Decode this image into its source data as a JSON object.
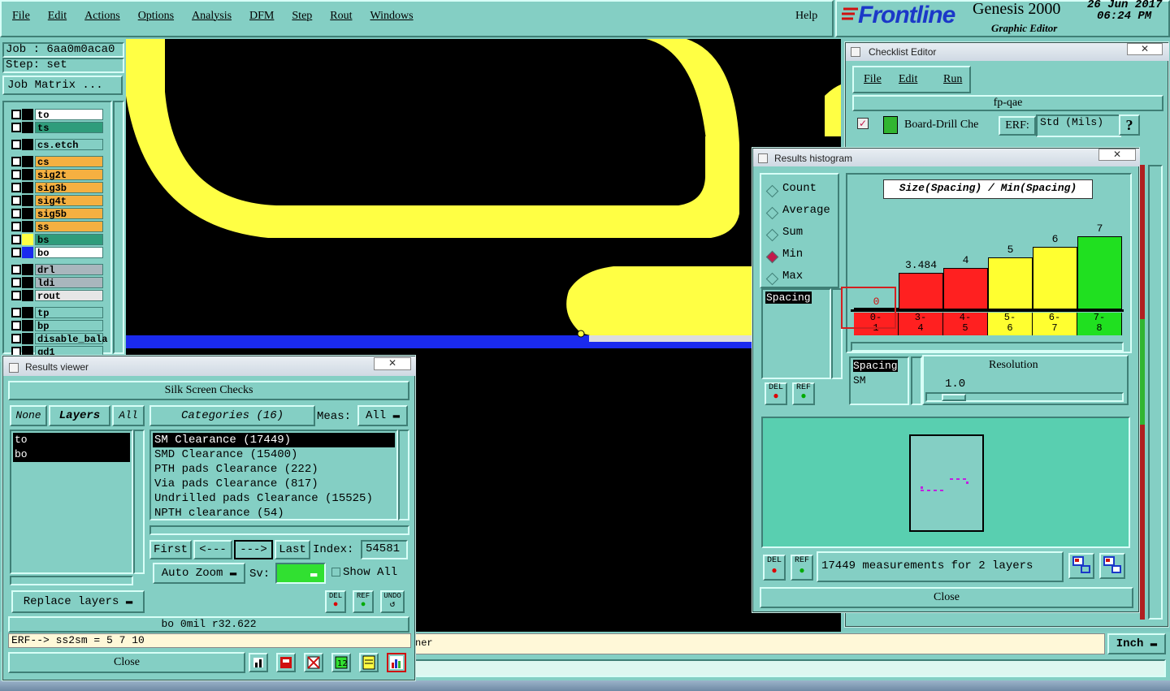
{
  "menu": [
    "File",
    "Edit",
    "Actions",
    "Options",
    "Analysis",
    "DFM",
    "Step",
    "Rout",
    "Windows"
  ],
  "help": "Help",
  "brand": {
    "logo": "Frontline",
    "product": "Genesis 2000",
    "subtitle": "Graphic Editor",
    "date": "26 Jun 2017",
    "time": "06:24 PM"
  },
  "job": {
    "job_label": "Job : 6aa0m0aca0",
    "step_label": "Step: set",
    "matrix_button": "Job Matrix ..."
  },
  "layers": [
    {
      "name": "to",
      "color": "#ffffff",
      "swatch": "#000000"
    },
    {
      "name": "ts",
      "color": "#2f9c7b",
      "swatch": "#000000"
    },
    {
      "name": "cs.etch",
      "color": "#84cfc4",
      "swatch": "#000000"
    },
    {
      "name": "cs",
      "color": "#f5b041",
      "swatch": "#000000"
    },
    {
      "name": "sig2t",
      "color": "#f5b041",
      "swatch": "#000000"
    },
    {
      "name": "sig3b",
      "color": "#f5b041",
      "swatch": "#000000"
    },
    {
      "name": "sig4t",
      "color": "#f5b041",
      "swatch": "#000000"
    },
    {
      "name": "sig5b",
      "color": "#f5b041",
      "swatch": "#000000"
    },
    {
      "name": "ss",
      "color": "#f5b041",
      "swatch": "#000000"
    },
    {
      "name": "bs",
      "color": "#2f9c7b",
      "swatch": "#ffff44"
    },
    {
      "name": "bo",
      "color": "#ffffff",
      "swatch": "#1a2aee"
    },
    {
      "name": "drl",
      "color": "#a9b6bd",
      "swatch": "#000000"
    },
    {
      "name": "ldi",
      "color": "#a9b6bd",
      "swatch": "#000000"
    },
    {
      "name": "rout",
      "color": "#e6e6e6",
      "swatch": "#000000"
    },
    {
      "name": "tp",
      "color": "#84cfc4",
      "swatch": "#000000"
    },
    {
      "name": "bp",
      "color": "#84cfc4",
      "swatch": "#000000"
    },
    {
      "name": "disable_bala",
      "color": "#84cfc4",
      "swatch": "#000000"
    },
    {
      "name": "gd1",
      "color": "#84cfc4",
      "swatch": "#000000"
    }
  ],
  "results_viewer": {
    "title": "Results viewer",
    "heading": "Silk Screen Checks",
    "none": "None",
    "layers": "Layers",
    "all": "All",
    "layer_items": [
      "to",
      "bo"
    ],
    "categories_btn": "Categories (16)",
    "meas_label": "Meas:",
    "meas_value": "All",
    "categories": [
      "SM Clearance (17449)",
      "SMD Clearance (15400)",
      "PTH pads Clearance (222)",
      "Via pads Clearance (817)",
      "Undrilled pads Clearance (15525)",
      "NPTH clearance (54)"
    ],
    "first": "First",
    "prev": "<---",
    "next": "--->",
    "last": "Last",
    "index_label": "Index:",
    "index_value": "54581",
    "auto_zoom": "Auto Zoom",
    "sv_label": "Sv:",
    "show_all": "Show All",
    "replace_layers": "Replace layers",
    "del": "DEL",
    "ref": "REF",
    "undo": "UNDO",
    "status": "bo 0mil   r32.622",
    "erf_line": "ERF--> ss2sm = 5 7 10",
    "close": "Close"
  },
  "checklist": {
    "title": "Checklist Editor",
    "menu": [
      "File",
      "Edit",
      "Run"
    ],
    "name": "fp-qae",
    "action_label": "Board-Drill Che",
    "erf_label": "ERF:",
    "erf_value": "Std (Mils)",
    "help": "?"
  },
  "histogram": {
    "title": "Results histogram",
    "modes": [
      "Count",
      "Average",
      "Sum",
      "Min",
      "Max"
    ],
    "selected_mode": "Min",
    "chart_title": "Size(Spacing) / Min(Spacing)",
    "measure_list": [
      "Spacing"
    ],
    "measure_list2": [
      "Spacing",
      "SM"
    ],
    "resolution_label": "Resolution",
    "resolution_value": "1.0",
    "del": "DEL",
    "ref": "REF",
    "summary": "17449 measurements for 2 layers",
    "close": "Close"
  },
  "chart_data": {
    "type": "bar",
    "title": "Size(Spacing) / Min(Spacing)",
    "categories": [
      "0-1",
      "3-4",
      "4-5",
      "5-6",
      "6-7",
      "7-8"
    ],
    "values": [
      0,
      3.484,
      4,
      5,
      6,
      7
    ],
    "value_labels": [
      "0",
      "3.484",
      "4",
      "5",
      "6",
      "7"
    ],
    "colors": [
      "#ff2020",
      "#ff2020",
      "#ff2020",
      "#ffff30",
      "#ffff30",
      "#20e020"
    ],
    "ylim": [
      0,
      7.5
    ]
  },
  "bottom": {
    "unit": "Inch",
    "partial_text": "ner"
  },
  "colors": {
    "canvas": "#000000",
    "trace": "#ffff44",
    "bottom_layer": "#1a2aee",
    "panel": "#84cfc4"
  }
}
